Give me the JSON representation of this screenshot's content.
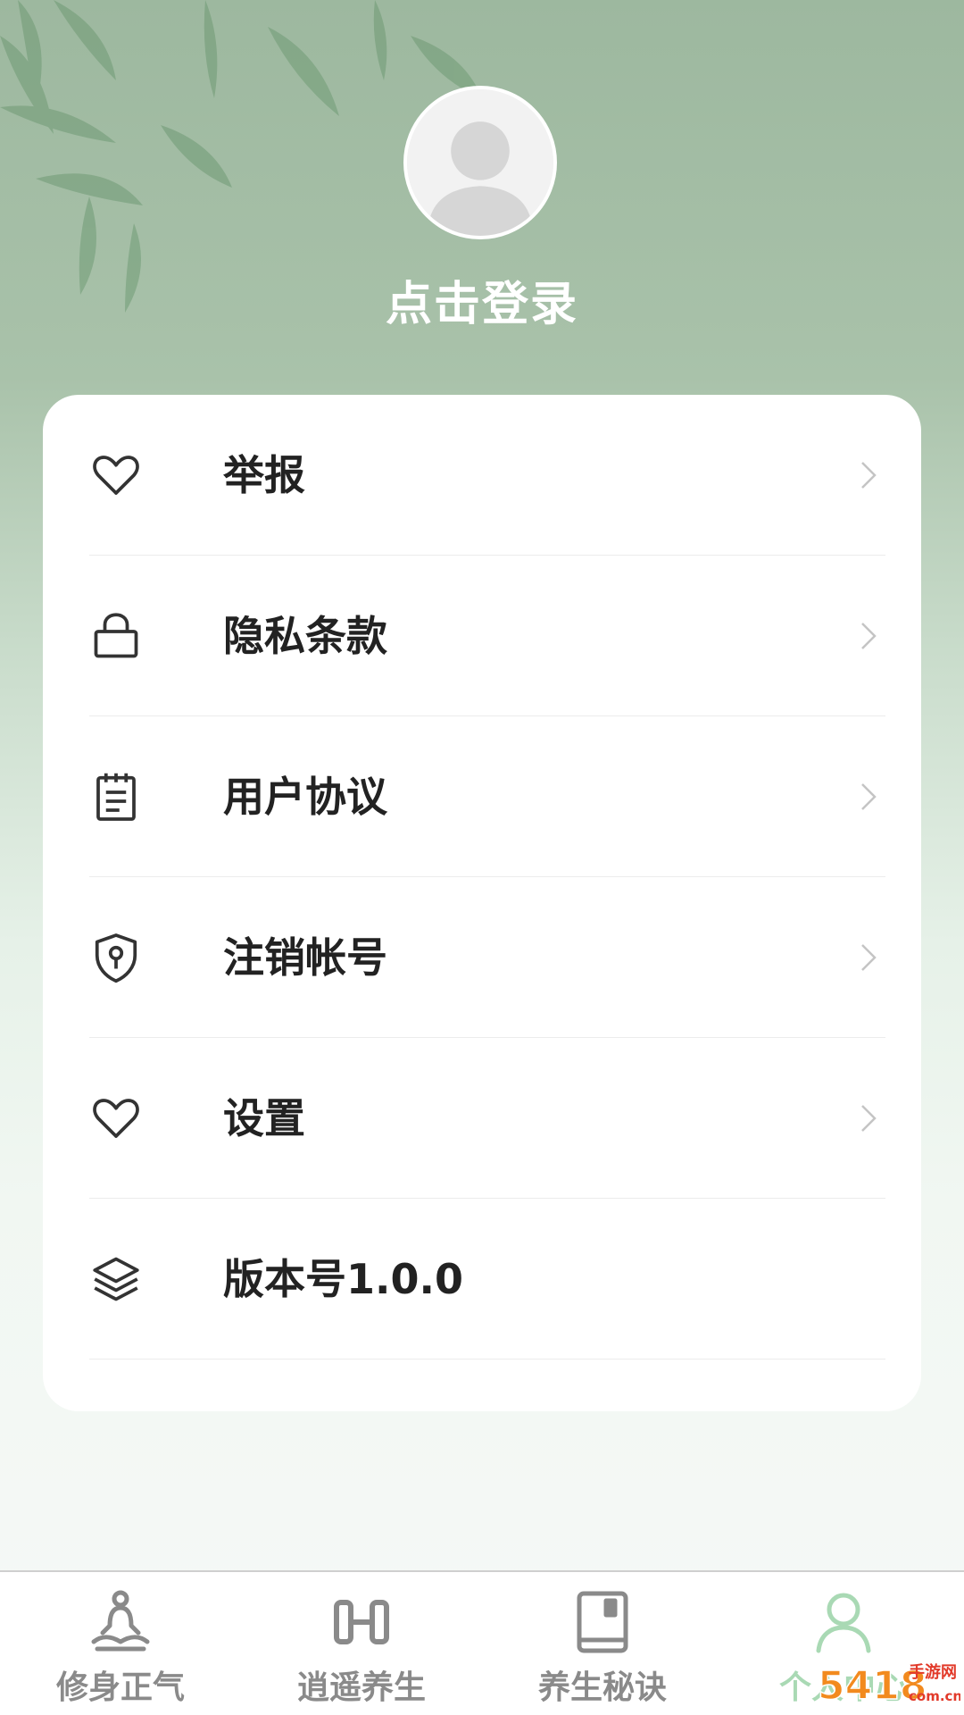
{
  "profile": {
    "avatar_icon": "default-avatar-icon",
    "login_label": "点击登录"
  },
  "menu": [
    {
      "label": "举报",
      "icon": "heart-icon",
      "arrow": true
    },
    {
      "label": "隐私条款",
      "icon": "lock-icon",
      "arrow": true
    },
    {
      "label": "用户协议",
      "icon": "notepad-icon",
      "arrow": true
    },
    {
      "label": "注销帐号",
      "icon": "shield-keyhole-icon",
      "arrow": true
    },
    {
      "label": "设置",
      "icon": "heart-icon",
      "arrow": true
    },
    {
      "label": "版本号1.0.0",
      "icon": "layers-icon",
      "arrow": false
    }
  ],
  "tabbar": [
    {
      "label": "修身正气",
      "icon": "meditation-icon",
      "active": false
    },
    {
      "label": "逍遥养生",
      "icon": "dumbbell-icon",
      "active": false
    },
    {
      "label": "养生秘诀",
      "icon": "book-icon",
      "active": false
    },
    {
      "label": "个人中心",
      "icon": "person-icon",
      "active": true
    }
  ],
  "watermark": {
    "number": "5418",
    "brand": "手游网",
    "domain": "com.cn"
  },
  "colors": {
    "header_green": "#9db89f",
    "active_tab": "#a9d9b4",
    "inactive_tab": "#8a8a8a",
    "text_dark": "#222222",
    "watermark_orange": "#f28a1e"
  }
}
